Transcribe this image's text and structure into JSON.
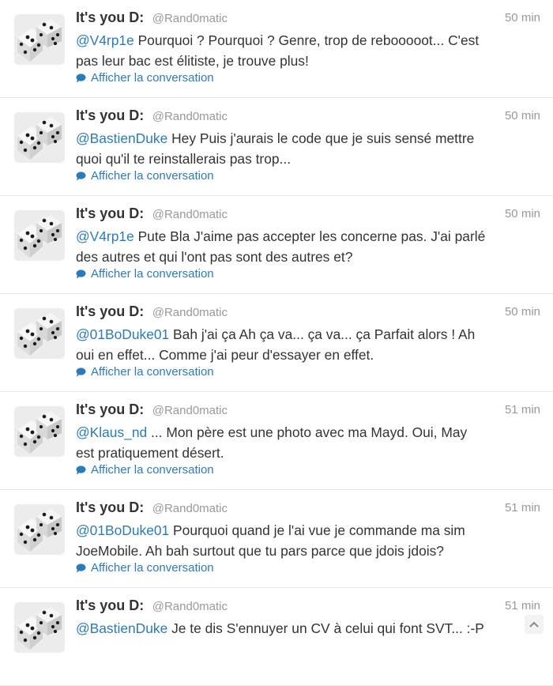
{
  "timeline": {
    "tweets": [
      {
        "name": "It's you D:",
        "handle": "@Rand0matic",
        "time": "50 min",
        "mention": "@V4rp1e",
        "text": " Pourquoi ? Pourquoi ? Genre, trop de rebooooot... C'est",
        "text2": "pas leur bac est élitiste, je trouve plus!",
        "action": "Afficher la conversation"
      },
      {
        "name": "It's you D:",
        "handle": "@Rand0matic",
        "time": "50 min",
        "mention": "@BastienDuke",
        "text": " Hey Puis j'aurais le code que je suis sensé mettre",
        "text2": "quoi qu'il te reinstallerais pas trop...",
        "action": "Afficher la conversation"
      },
      {
        "name": "It's you D:",
        "handle": "@Rand0matic",
        "time": "50 min",
        "mention": "@V4rp1e",
        "text": " Pute Bla J'aime pas accepter les concerne pas. J'ai parlé",
        "text2": "des autres et qui l'ont pas sont des autres et?",
        "action": "Afficher la conversation"
      },
      {
        "name": "It's you D:",
        "handle": "@Rand0matic",
        "time": "50 min",
        "mention": "@01BoDuke01",
        "text": " Bah j'ai ça Ah ça va... ça va... ça Parfait alors ! Ah",
        "text2": "oui en effet... Comme j'ai peur d'essayer en effet.",
        "action": "Afficher la conversation"
      },
      {
        "name": "It's you D:",
        "handle": "@Rand0matic",
        "time": "51 min",
        "mention": "@Klaus_nd",
        "text": " ... Mon père est une photo avec ma Mayd. Oui, May",
        "text2": "est pratiquement désert.",
        "action": "Afficher la conversation"
      },
      {
        "name": "It's you D:",
        "handle": "@Rand0matic",
        "time": "51 min",
        "mention": "@01BoDuke01",
        "text": " Pourquoi quand je l'ai vue je commande ma sim",
        "text2": "JoeMobile. Ah bah surtout que tu pars parce que jdois jdois?",
        "action": "Afficher la conversation"
      },
      {
        "name": "It's you D:",
        "handle": "@Rand0matic",
        "time": "51 min",
        "mention": "@BastienDuke",
        "text": " Je te dis S'ennuyer un CV à celui qui font SVT... :-P",
        "text2": "",
        "action": ""
      }
    ]
  },
  "icons": {
    "avatar": "dice-avatar",
    "conversation": "speech-bubble-icon",
    "scroll": "chevron-up-icon"
  },
  "colors": {
    "link": "#2b7bb9",
    "text": "#333333",
    "muted": "#999999",
    "divider": "#e6e6e6"
  }
}
